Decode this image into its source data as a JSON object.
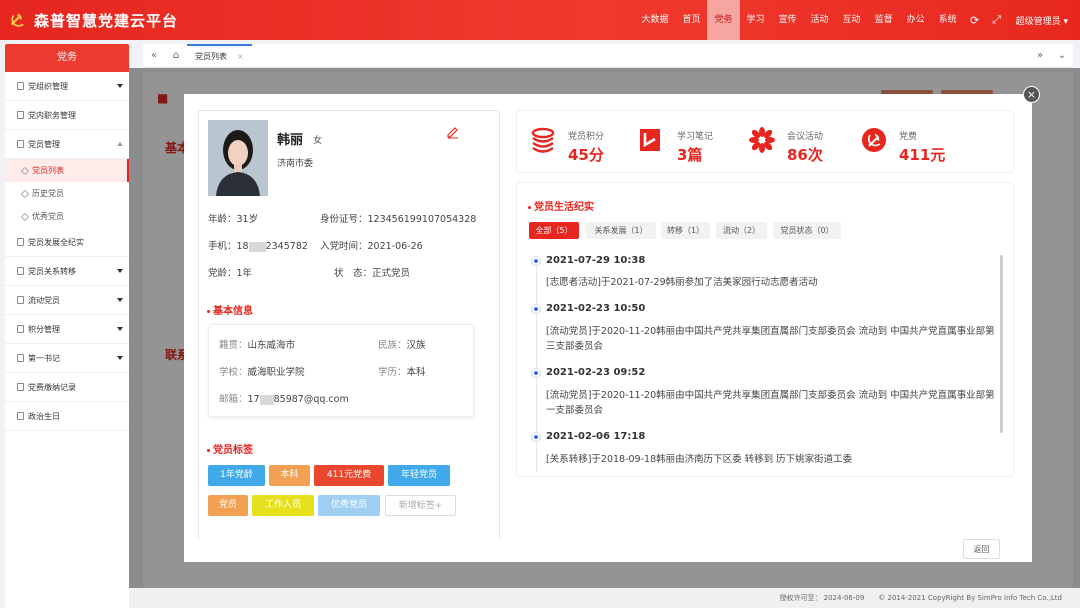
{
  "header": {
    "title": "森普智慧党建云平台",
    "nav": [
      "大数据",
      "首页",
      "党务",
      "学习",
      "宣传",
      "活动",
      "互动",
      "监督",
      "办公",
      "系统"
    ],
    "active_nav": "党务",
    "admin_label": "超级管理员 ▾"
  },
  "sidebar": {
    "head": "党务",
    "items": [
      {
        "label": "党组织管理",
        "arrow": "down"
      },
      {
        "label": "党内职务管理",
        "arrow": ""
      },
      {
        "label": "党员管理",
        "arrow": "up"
      },
      {
        "label": "党员发展全纪实",
        "arrow": ""
      },
      {
        "label": "党员关系转移",
        "arrow": "down"
      },
      {
        "label": "流动党员",
        "arrow": "down"
      },
      {
        "label": "积分管理",
        "arrow": "down"
      },
      {
        "label": "第一书记",
        "arrow": "down"
      },
      {
        "label": "党费缴纳记录",
        "arrow": ""
      },
      {
        "label": "政治生日",
        "arrow": ""
      }
    ],
    "subitems": [
      "党员列表",
      "历史党员",
      "优秀党员"
    ]
  },
  "tabs": {
    "active": "党员列表"
  },
  "background": {
    "heading1": "基本",
    "heading2": "联系"
  },
  "profile": {
    "name": "韩丽",
    "gender": "女",
    "org": "济南市委",
    "age": "年龄：31岁",
    "id_number": "身份证号：123456199107054328",
    "phone_prefix": "手机：18",
    "phone_suffix": "2345782",
    "join_date": "入党时间：2021-06-26",
    "party_age": "党龄：1年",
    "status": "状　态：正式党员"
  },
  "basic_info": {
    "title": "基本信息",
    "native_k": "籍贯：",
    "native_v": "山东威海市",
    "ethnic_k": "民族：",
    "ethnic_v": "汉族",
    "school_k": "学校：",
    "school_v": "威海职业学院",
    "edu_k": "学历：",
    "edu_v": "本科",
    "email_k": "邮箱：",
    "email_prefix": "17",
    "email_suffix": "85987@qq.com"
  },
  "tags": {
    "title": "党员标签",
    "items": [
      {
        "label": "1年党龄",
        "color": "#3fa9ea"
      },
      {
        "label": "本科",
        "color": "#f2a052"
      },
      {
        "label": "411元党费",
        "color": "#e9472e"
      },
      {
        "label": "年轻党员",
        "color": "#3fa9ea"
      },
      {
        "label": "党员",
        "color": "#f2a052"
      },
      {
        "label": "工作人员",
        "color": "#e6e01c"
      },
      {
        "label": "优秀党员",
        "color": "#9fd0f3"
      }
    ],
    "add_label": "新增标签+"
  },
  "stats": [
    {
      "label": "党员积分",
      "value": "45分",
      "icon": "coins-icon"
    },
    {
      "label": "学习笔记",
      "value": "3篇",
      "icon": "note-icon"
    },
    {
      "label": "会议活动",
      "value": "86次",
      "icon": "flower-icon"
    },
    {
      "label": "党费",
      "value": "411元",
      "icon": "party-emblem-icon"
    }
  ],
  "life": {
    "title": "党员生活纪实",
    "filters": [
      "全部（5）",
      "关系发展（1）",
      "转移（1）",
      "流动（2）",
      "党员状态（0）"
    ],
    "active_filter": "全部（5）",
    "events": [
      {
        "time": "2021-07-29 10:38",
        "text": "[志愿者活动]于2021-07-29韩丽参加了洁美家园行动志愿者活动"
      },
      {
        "time": "2021-02-23 10:50",
        "text": "[流动党员]于2020-11-20韩丽由中国共产党共享集团直属部门支部委员会 流动到 中国共产党直属事业部第三支部委员会"
      },
      {
        "time": "2021-02-23 09:52",
        "text": "[流动党员]于2020-11-20韩丽由中国共产党共享集团直属部门支部委员会 流动到 中国共产党直属事业部第一支部委员会"
      },
      {
        "time": "2021-02-06 17:18",
        "text": "[关系转移]于2018-09-18韩丽由济南历下区委 转移到 历下姚家街道工委"
      }
    ]
  },
  "return_label": "返回",
  "footer": {
    "license": "授权许可至：",
    "license_date": "2024-06-09",
    "copyright": "© 2014-2021 CopyRight By SimPro Info Tech Co.,Ltd"
  }
}
